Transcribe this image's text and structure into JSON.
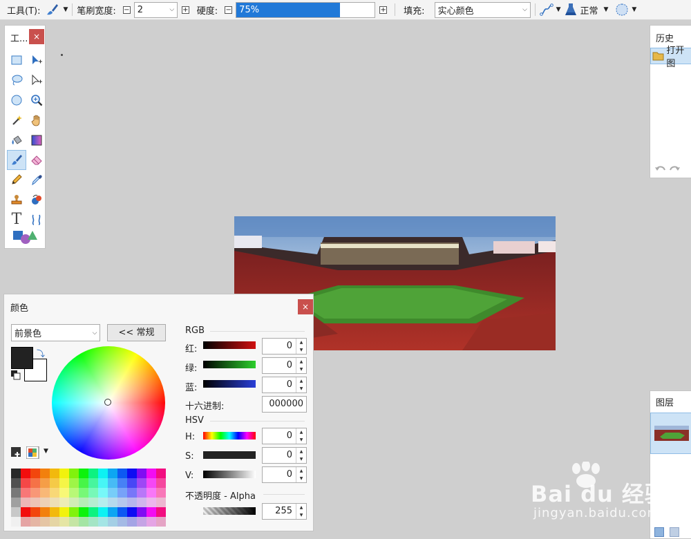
{
  "toolbar": {
    "tool_label": "工具(T):",
    "brush_width_label": "笔刷宽度:",
    "brush_width_value": "2",
    "hardness_label": "硬度:",
    "hardness_value": "75%",
    "hardness_fraction": 0.75,
    "fill_label": "填充:",
    "fill_value": "实心颜色",
    "blend_mode": "正常"
  },
  "toolbox": {
    "title": "工...",
    "close": "×",
    "tools": [
      "rectangle-select-icon",
      "move-selection-icon",
      "lasso-select-icon",
      "move-selected-icon",
      "ellipse-select-icon",
      "zoom-icon",
      "magic-wand-icon",
      "pan-icon",
      "paint-bucket-icon",
      "gradient-icon",
      "paintbrush-icon",
      "eraser-icon",
      "pencil-icon",
      "color-picker-icon",
      "clone-stamp-icon",
      "recolor-icon",
      "text-icon",
      "line-curve-icon",
      "shapes-icon"
    ],
    "text_tool_glyph": "T"
  },
  "history": {
    "title": "历史",
    "item": "打开图"
  },
  "layers": {
    "title": "图层"
  },
  "colors": {
    "title": "颜色",
    "close": "×",
    "target": "前景色",
    "toggle_button": "<< 常规",
    "rgb_label": "RGB",
    "red_label": "红:",
    "green_label": "绿:",
    "blue_label": "蓝:",
    "red_value": "0",
    "green_value": "0",
    "blue_value": "0",
    "hex_label": "十六进制:",
    "hex_value": "000000",
    "hsv_label": "HSV",
    "h_label": "H:",
    "s_label": "S:",
    "v_label": "V:",
    "h_value": "0",
    "s_value": "0",
    "v_value": "0",
    "alpha_label": "不透明度 - Alpha",
    "alpha_value": "255",
    "primary_color": "#222222",
    "secondary_color": "#ffffff"
  },
  "watermark": {
    "brand": "Bai du 经验",
    "url": "jingyan.baidu.com"
  },
  "accent": "#2179d8"
}
